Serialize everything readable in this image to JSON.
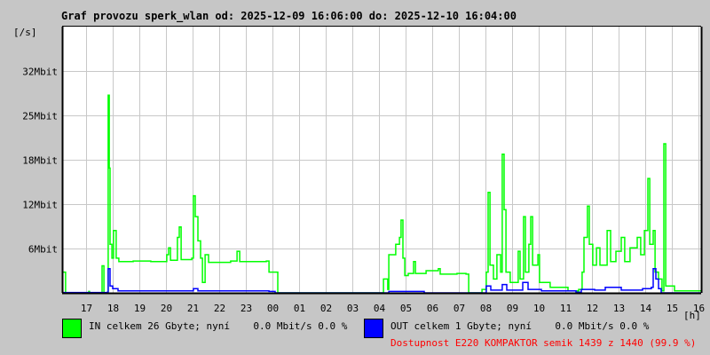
{
  "chart_data": {
    "type": "line",
    "title": "Graf provozu sperk_wlan od: 2025-12-09 16:06:00 do: 2025-12-10 16:04:00",
    "ylabel": "[/s]",
    "xlabel": "[h]",
    "x_unit": "hours since 2025-12-09 16:06",
    "xlim": [
      0,
      24
    ],
    "ylim": [
      0,
      38.4
    ],
    "grid": true,
    "y_ticks": [
      {
        "value": 6.4,
        "label": "6Mbit"
      },
      {
        "value": 12.8,
        "label": "12Mbit"
      },
      {
        "value": 19.2,
        "label": "18Mbit"
      },
      {
        "value": 25.6,
        "label": "25Mbit"
      },
      {
        "value": 32,
        "label": "32Mbit"
      }
    ],
    "x_ticks": [
      {
        "value": 0.9,
        "label": "17"
      },
      {
        "value": 1.9,
        "label": "18"
      },
      {
        "value": 2.9,
        "label": "19"
      },
      {
        "value": 3.9,
        "label": "20"
      },
      {
        "value": 4.9,
        "label": "21"
      },
      {
        "value": 5.9,
        "label": "22"
      },
      {
        "value": 6.9,
        "label": "23"
      },
      {
        "value": 7.9,
        "label": "00"
      },
      {
        "value": 8.9,
        "label": "01"
      },
      {
        "value": 9.9,
        "label": "02"
      },
      {
        "value": 10.9,
        "label": "03"
      },
      {
        "value": 11.9,
        "label": "04"
      },
      {
        "value": 12.9,
        "label": "05"
      },
      {
        "value": 13.9,
        "label": "06"
      },
      {
        "value": 14.9,
        "label": "07"
      },
      {
        "value": 15.9,
        "label": "08"
      },
      {
        "value": 16.9,
        "label": "09"
      },
      {
        "value": 17.9,
        "label": "10"
      },
      {
        "value": 18.9,
        "label": "11"
      },
      {
        "value": 19.9,
        "label": "12"
      },
      {
        "value": 20.9,
        "label": "13"
      },
      {
        "value": 21.9,
        "label": "14"
      },
      {
        "value": 22.9,
        "label": "15"
      },
      {
        "value": 23.9,
        "label": "16"
      }
    ],
    "series": [
      {
        "name": "IN",
        "color": "#00ff00",
        "unit": "Mbit/s",
        "points": [
          [
            0,
            3.0
          ],
          [
            0.1,
            3.0
          ],
          [
            0.13,
            0
          ],
          [
            1.0,
            0.2
          ],
          [
            1.03,
            0
          ],
          [
            1.47,
            0
          ],
          [
            1.5,
            3.9
          ],
          [
            1.57,
            0
          ],
          [
            1.7,
            0
          ],
          [
            1.73,
            28.5
          ],
          [
            1.77,
            18
          ],
          [
            1.8,
            7
          ],
          [
            1.87,
            5
          ],
          [
            1.93,
            9
          ],
          [
            2.03,
            5
          ],
          [
            2.13,
            4.5
          ],
          [
            2.67,
            4.6
          ],
          [
            3.33,
            4.5
          ],
          [
            3.93,
            5.5
          ],
          [
            4.0,
            6.5
          ],
          [
            4.07,
            4.7
          ],
          [
            4.33,
            8
          ],
          [
            4.4,
            9.5
          ],
          [
            4.47,
            4.8
          ],
          [
            4.87,
            5
          ],
          [
            4.93,
            14
          ],
          [
            5.0,
            11
          ],
          [
            5.1,
            7.5
          ],
          [
            5.2,
            5
          ],
          [
            5.27,
            1.5
          ],
          [
            5.37,
            5.5
          ],
          [
            5.5,
            4.4
          ],
          [
            6.33,
            4.6
          ],
          [
            6.57,
            6
          ],
          [
            6.67,
            4.5
          ],
          [
            7.67,
            4.6
          ],
          [
            7.77,
            3
          ],
          [
            8.0,
            3
          ],
          [
            8.1,
            0
          ],
          [
            12.0,
            0
          ],
          [
            12.07,
            2
          ],
          [
            12.23,
            0.5
          ],
          [
            12.27,
            5.5
          ],
          [
            12.53,
            7
          ],
          [
            12.67,
            8
          ],
          [
            12.73,
            10.5
          ],
          [
            12.8,
            5
          ],
          [
            12.87,
            2.5
          ],
          [
            13.0,
            2.8
          ],
          [
            13.2,
            4.5
          ],
          [
            13.27,
            2.8
          ],
          [
            13.67,
            3.2
          ],
          [
            14.13,
            3.5
          ],
          [
            14.2,
            2.7
          ],
          [
            14.83,
            2.8
          ],
          [
            15.17,
            2.7
          ],
          [
            15.27,
            0
          ],
          [
            15.77,
            0.5
          ],
          [
            15.93,
            3
          ],
          [
            16.0,
            14.5
          ],
          [
            16.07,
            4
          ],
          [
            16.2,
            2
          ],
          [
            16.33,
            5.5
          ],
          [
            16.47,
            3
          ],
          [
            16.53,
            20
          ],
          [
            16.6,
            12
          ],
          [
            16.67,
            3
          ],
          [
            16.83,
            1.5
          ],
          [
            17.13,
            6
          ],
          [
            17.2,
            2
          ],
          [
            17.33,
            11
          ],
          [
            17.4,
            3
          ],
          [
            17.53,
            7
          ],
          [
            17.6,
            11
          ],
          [
            17.67,
            4
          ],
          [
            17.87,
            5.5
          ],
          [
            17.93,
            1.5
          ],
          [
            18.33,
            0.8
          ],
          [
            19.0,
            0.3
          ],
          [
            19.4,
            0.5
          ],
          [
            19.53,
            3
          ],
          [
            19.6,
            8
          ],
          [
            19.73,
            12.5
          ],
          [
            19.8,
            7
          ],
          [
            19.93,
            4
          ],
          [
            20.07,
            6.5
          ],
          [
            20.2,
            4
          ],
          [
            20.47,
            9
          ],
          [
            20.6,
            4.5
          ],
          [
            20.8,
            6
          ],
          [
            21.0,
            8
          ],
          [
            21.13,
            4.5
          ],
          [
            21.33,
            6.5
          ],
          [
            21.6,
            8
          ],
          [
            21.73,
            5.5
          ],
          [
            21.87,
            9
          ],
          [
            22.0,
            16.5
          ],
          [
            22.07,
            7
          ],
          [
            22.2,
            9
          ],
          [
            22.27,
            3
          ],
          [
            22.4,
            2
          ],
          [
            22.53,
            0.3
          ],
          [
            22.6,
            21.5
          ],
          [
            22.67,
            1
          ],
          [
            23.0,
            0.3
          ],
          [
            24.0,
            0.2
          ]
        ]
      },
      {
        "name": "OUT",
        "color": "#0000ff",
        "unit": "Mbit/s",
        "points": [
          [
            0,
            0.05
          ],
          [
            1.7,
            0.1
          ],
          [
            1.73,
            3.5
          ],
          [
            1.8,
            1
          ],
          [
            1.9,
            0.6
          ],
          [
            2.1,
            0.3
          ],
          [
            4.8,
            0.3
          ],
          [
            4.93,
            0.6
          ],
          [
            5.1,
            0.3
          ],
          [
            7.77,
            0.2
          ],
          [
            8.0,
            0
          ],
          [
            12.27,
            0.2
          ],
          [
            13.5,
            0.2
          ],
          [
            13.6,
            0
          ],
          [
            15.7,
            0
          ],
          [
            15.93,
            1
          ],
          [
            16.1,
            0.4
          ],
          [
            16.53,
            1.2
          ],
          [
            16.7,
            0.4
          ],
          [
            17.3,
            1.5
          ],
          [
            17.5,
            0.5
          ],
          [
            18.0,
            0.3
          ],
          [
            19.3,
            0.1
          ],
          [
            19.5,
            0.5
          ],
          [
            20.0,
            0.4
          ],
          [
            20.4,
            0.8
          ],
          [
            21.0,
            0.4
          ],
          [
            21.8,
            0.6
          ],
          [
            22.13,
            0.8
          ],
          [
            22.2,
            3.5
          ],
          [
            22.3,
            2
          ],
          [
            22.4,
            0.6
          ],
          [
            22.5,
            0
          ],
          [
            24,
            0
          ]
        ]
      }
    ]
  },
  "legend": {
    "in_text": "IN celkem 26 Gbyte; nyní    0.0 Mbit/s 0.0 %",
    "out_text": "OUT celkem 1 Gbyte; nyní    0.0 Mbit/s 0.0 %",
    "availability": "Dostupnost E220 KOMPAKTOR semik 1439 z 1440 (99.9 %)",
    "in_color": "#00ff00",
    "out_color": "#0000ff",
    "availability_color": "#ff0000"
  }
}
